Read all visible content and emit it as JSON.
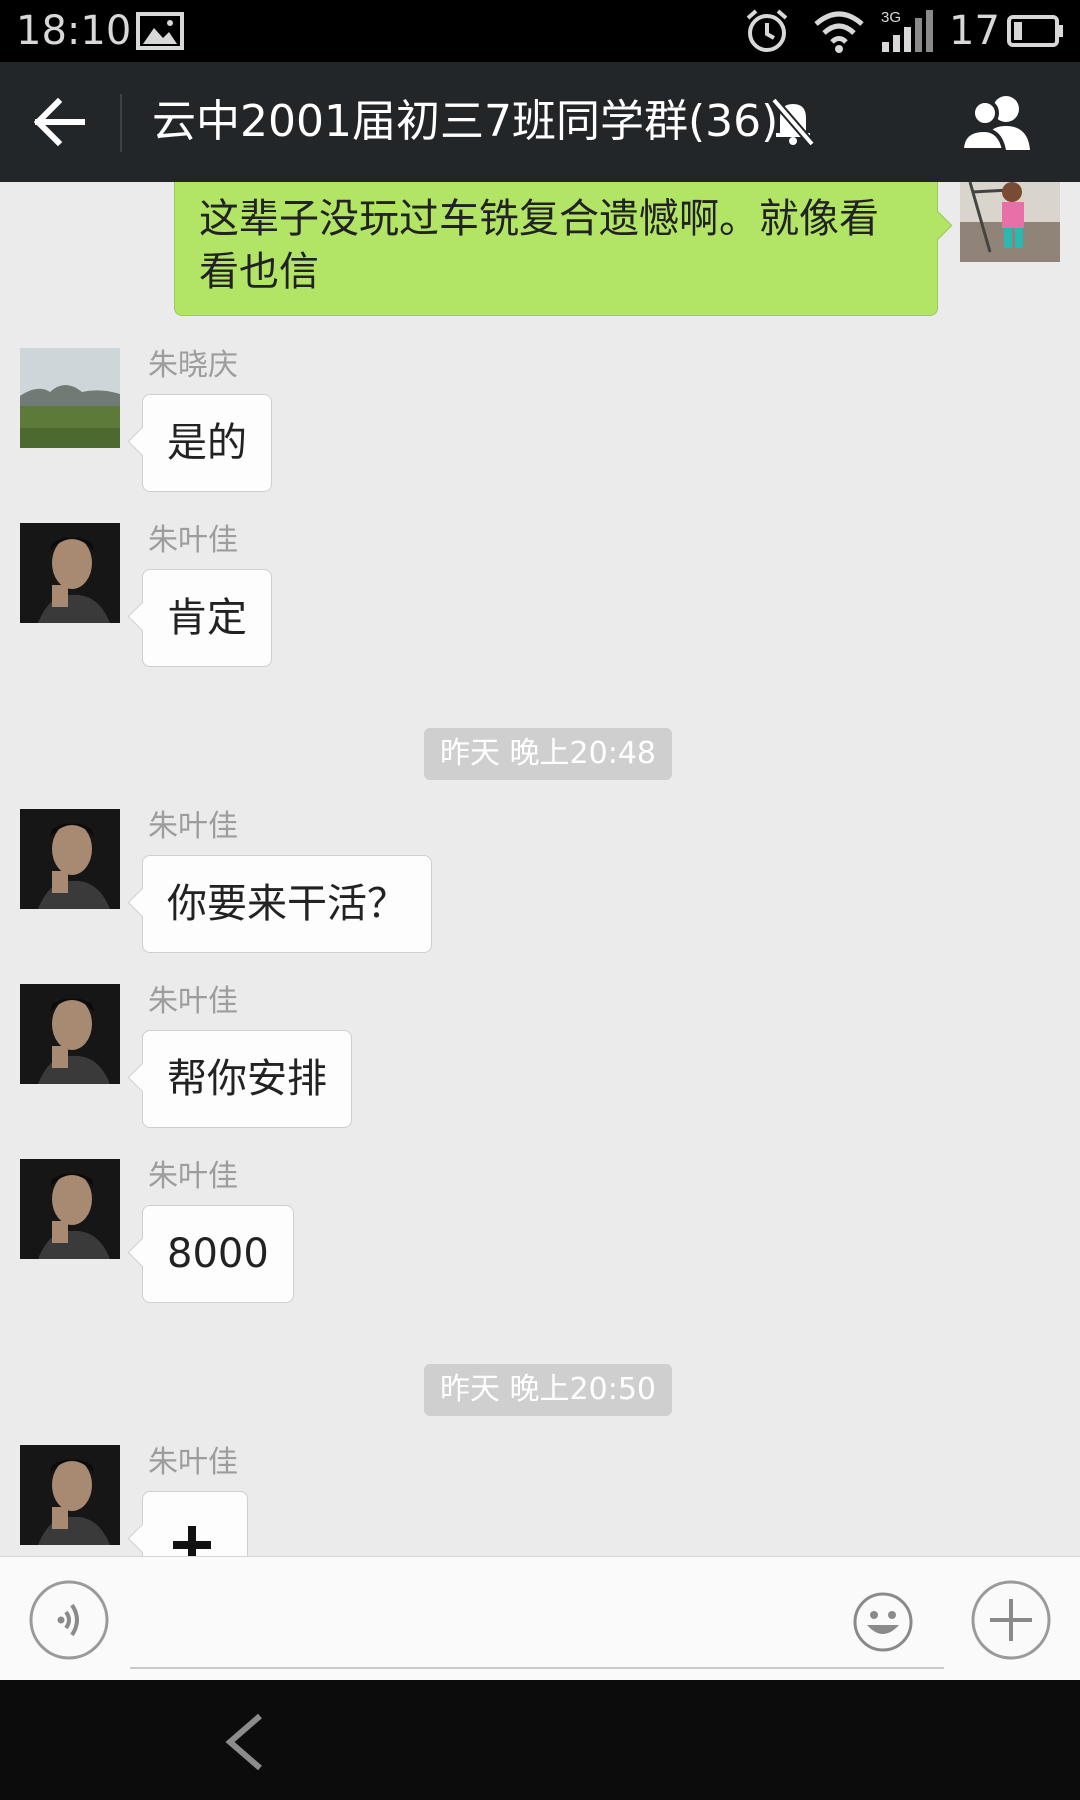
{
  "status_bar": {
    "time": "18:10",
    "network": "3G",
    "battery": "17",
    "icons": [
      "image-icon",
      "alarm-icon",
      "wifi-icon",
      "signal-icon",
      "battery-icon"
    ]
  },
  "header": {
    "title": "云中2001届初三7班同学群(36)",
    "icons": [
      "back-arrow-icon",
      "mute-bell-icon",
      "group-members-icon"
    ]
  },
  "messages": {
    "m0": {
      "text": "这辈子没玩过车铣复合遗憾啊。就像看看也信"
    },
    "m1": {
      "sender": "朱晓庆",
      "text": "是的"
    },
    "m2": {
      "sender": "朱叶佳",
      "text": "肯定"
    },
    "ts1": "昨天 晚上20:48",
    "m3": {
      "sender": "朱叶佳",
      "text": "你要来干活？"
    },
    "m4": {
      "sender": "朱叶佳",
      "text": "帮你安排"
    },
    "m5": {
      "sender": "朱叶佳",
      "text": "8000"
    },
    "ts2": "昨天 晚上20:50",
    "m6": {
      "sender": "朱叶佳",
      "content_icon": "plus-icon"
    }
  },
  "input_bar": {
    "value": "",
    "icons": [
      "voice-icon",
      "emoji-icon",
      "add-more-icon"
    ]
  },
  "nav_bar": {
    "icons": [
      "nav-back-icon"
    ]
  },
  "colors": {
    "status_bar_bg": "#000000",
    "title_bar_bg": "#232628",
    "chat_bg": "#ebebeb",
    "my_bubble": "#b2e466",
    "other_bubble": "#fdfdfd",
    "timestamp_bg": "#cfcfcf"
  }
}
